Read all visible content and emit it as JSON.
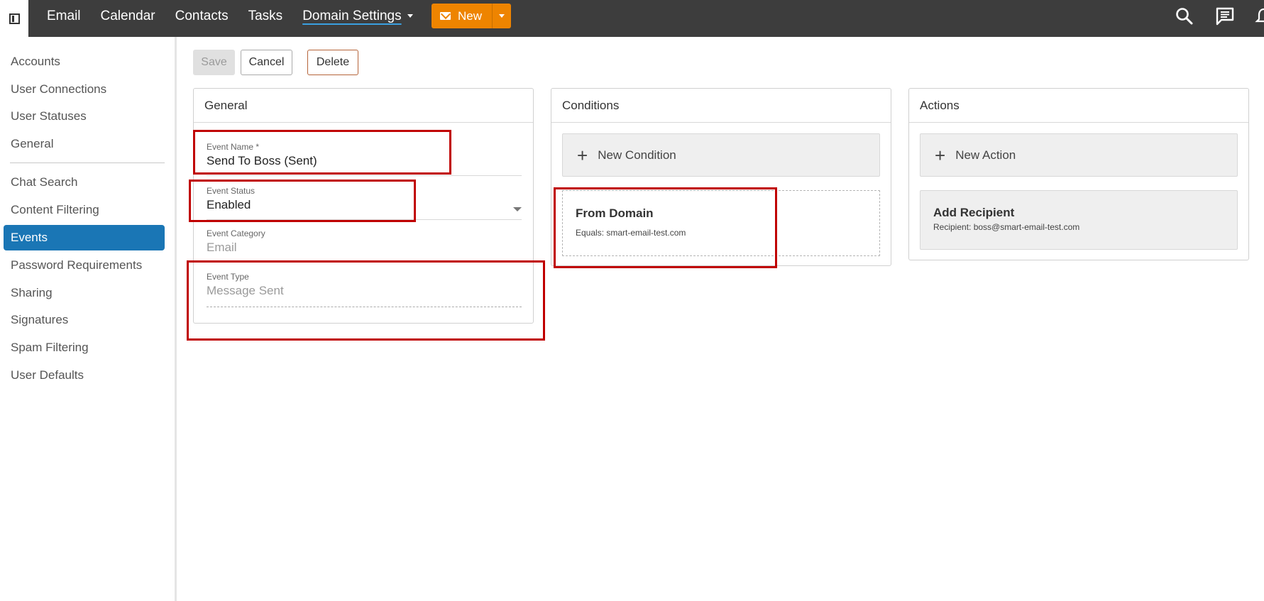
{
  "nav": {
    "items": [
      "Email",
      "Calendar",
      "Contacts",
      "Tasks"
    ],
    "active_item": "Domain Settings",
    "new_label": "New"
  },
  "sidebar": {
    "items": [
      "Accounts",
      "User Connections",
      "User Statuses",
      "General",
      "Chat Search",
      "Content Filtering",
      "Events",
      "Password Requirements",
      "Sharing",
      "Signatures",
      "Spam Filtering",
      "User Defaults"
    ],
    "active": "Events"
  },
  "toolbar": {
    "save_label": "Save",
    "cancel_label": "Cancel",
    "delete_label": "Delete"
  },
  "general": {
    "title": "General",
    "event_name": {
      "label": "Event Name *",
      "value": "Send To Boss (Sent)"
    },
    "event_status": {
      "label": "Event Status",
      "value": "Enabled"
    },
    "event_category": {
      "label": "Event Category",
      "value": "Email"
    },
    "event_type": {
      "label": "Event Type",
      "value": "Message Sent"
    }
  },
  "conditions": {
    "title": "Conditions",
    "new_label": "New Condition",
    "items": [
      {
        "title": "From Domain",
        "detail": "Equals: smart-email-test.com"
      }
    ]
  },
  "actions": {
    "title": "Actions",
    "new_label": "New Action",
    "items": [
      {
        "title": "Add Recipient",
        "detail": "Recipient: boss@smart-email-test.com"
      }
    ]
  },
  "colors": {
    "topbar": "#3d3d3d",
    "accent": "#ee8400",
    "active_blue": "#1a76b5",
    "highlight": "#c00000"
  },
  "icons": [
    "sidebar-toggle-icon",
    "mail-icon",
    "search-icon",
    "chat-icon",
    "bell-icon",
    "plus-icon"
  ]
}
